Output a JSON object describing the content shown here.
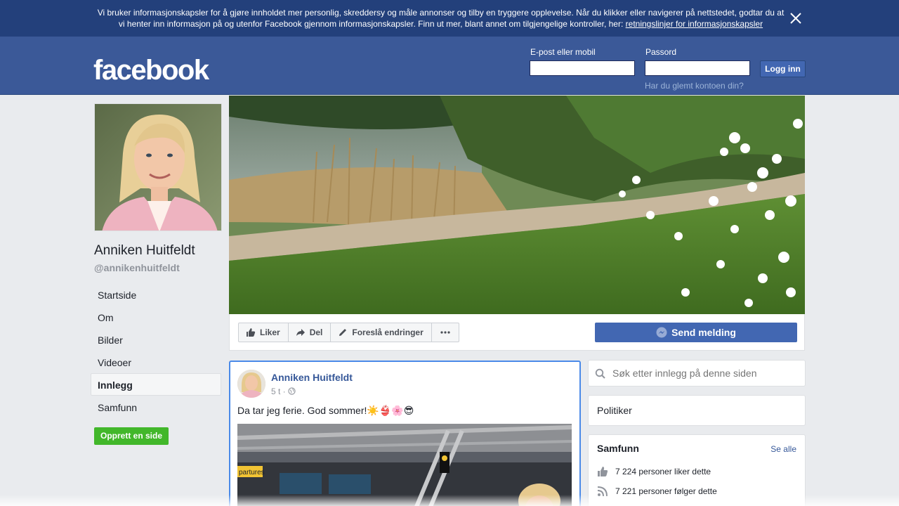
{
  "cookie_banner": {
    "text_line1": "Vi bruker informasjonskapsler for å gjøre innholdet mer personlig, skreddersy og måle annonser og tilby en tryggere opplevelse. Når du klikker eller navigerer på nettstedet, godtar du at",
    "text_line2": "vi henter inn informasjon på og utenfor Facebook gjennom informasjonskapsler. Finn ut mer, blant annet om tilgjengelige kontroller, her:",
    "link": "retningslinjer for informasjonskapsler",
    "close_icon": "close-icon"
  },
  "header": {
    "logo": "facebook",
    "email_label": "E-post eller mobil",
    "email_value": "",
    "password_label": "Passord",
    "password_value": "",
    "login_button": "Logg inn",
    "forgot_link": "Har du glemt kontoen din?"
  },
  "profile": {
    "name": "Anniken Huitfeldt",
    "handle": "@annikenhuitfeldt"
  },
  "nav": {
    "items": [
      {
        "label": "Startside"
      },
      {
        "label": "Om"
      },
      {
        "label": "Bilder"
      },
      {
        "label": "Videoer"
      },
      {
        "label": "Innlegg",
        "active": true
      },
      {
        "label": "Samfunn"
      }
    ],
    "create_page": "Opprett en side"
  },
  "actions": {
    "like": "Liker",
    "share": "Del",
    "suggest": "Foreslå endringer",
    "more_icon": "more-icon",
    "send_message": "Send melding"
  },
  "post": {
    "author": "Anniken Huitfeldt",
    "time": "5 t ·",
    "text": "Da tar jeg ferie. God sommer!",
    "emojis": "☀️👙🌸😎",
    "photo_sign": "partures"
  },
  "sidebar": {
    "search_placeholder": "Søk etter innlegg på denne siden",
    "category": "Politiker",
    "community_title": "Samfunn",
    "see_all": "Se alle",
    "likes": "7 224 personer liker dette",
    "follows": "7 221 personer følger dette"
  },
  "colors": {
    "brand": "#3b5998",
    "banner": "#23407b",
    "button": "#4267b2",
    "green": "#42b72a"
  }
}
